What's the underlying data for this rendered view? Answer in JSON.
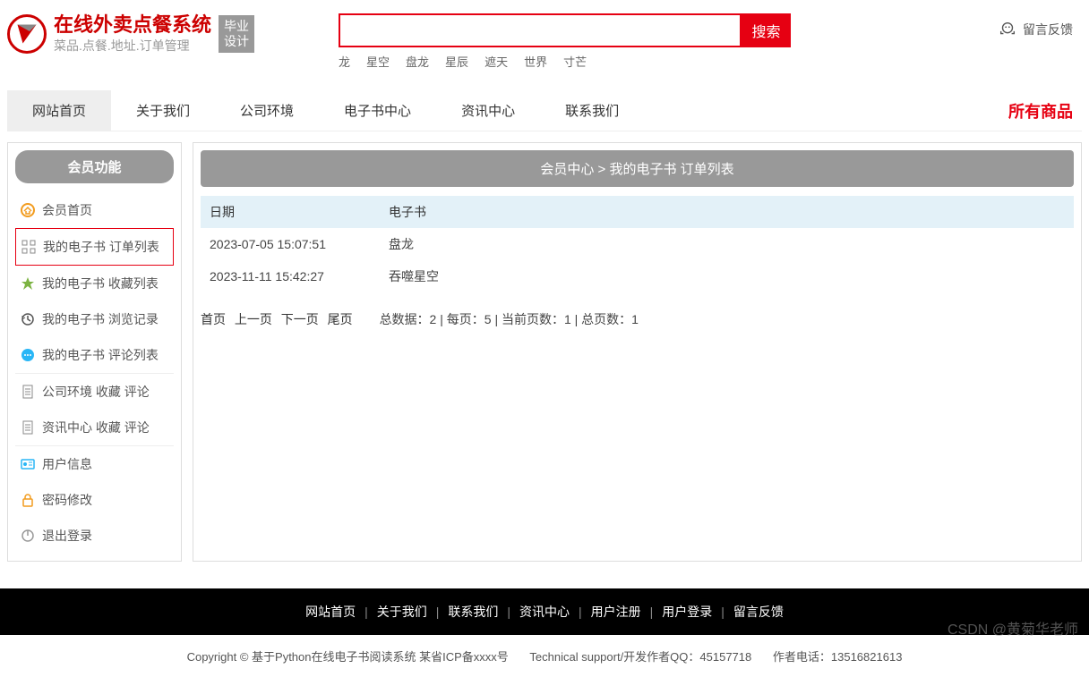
{
  "header": {
    "title": "在线外卖点餐系统",
    "subtitle": "菜品.点餐.地址.订单管理",
    "badge_line1": "毕业",
    "badge_line2": "设计",
    "search_button": "搜索",
    "search_placeholder": "",
    "hot_words": [
      "龙",
      "星空",
      "盘龙",
      "星辰",
      "遮天",
      "世界",
      "寸芒"
    ],
    "feedback": "留言反馈"
  },
  "nav": {
    "items": [
      "网站首页",
      "关于我们",
      "公司环境",
      "电子书中心",
      "资讯中心",
      "联系我们"
    ],
    "right": "所有商品"
  },
  "sidebar": {
    "header": "会员功能",
    "items": [
      {
        "label": "会员首页",
        "icon": "home",
        "color": "#F29C1F"
      },
      {
        "label": "我的电子书 订单列表",
        "icon": "grid",
        "color": "#888",
        "selected": true
      },
      {
        "label": "我的电子书 收藏列表",
        "icon": "star",
        "color": "#7CB342"
      },
      {
        "label": "我的电子书 浏览记录",
        "icon": "history",
        "color": "#555"
      },
      {
        "label": "我的电子书 评论列表",
        "icon": "comment",
        "color": "#29B6F6",
        "sep": true
      },
      {
        "label": "公司环境   收藏   评论",
        "icon": "doc",
        "color": "#888"
      },
      {
        "label": "资讯中心   收藏   评论",
        "icon": "doc",
        "color": "#888",
        "sep": true
      },
      {
        "label": "用户信息",
        "icon": "card",
        "color": "#29B6F6"
      },
      {
        "label": "密码修改",
        "icon": "lock",
        "color": "#F29C1F"
      },
      {
        "label": "退出登录",
        "icon": "power",
        "color": "#999"
      }
    ]
  },
  "main": {
    "breadcrumb": "会员中心 > 我的电子书 订单列表",
    "columns": [
      "日期",
      "电子书",
      ""
    ],
    "rows": [
      {
        "date": "2023-07-05 15:07:51",
        "book": "盘龙"
      },
      {
        "date": "2023-11-11 15:42:27",
        "book": "吞噬星空"
      }
    ],
    "pager": {
      "first": "首页",
      "prev": "上一页",
      "next": "下一页",
      "last": "尾页",
      "stats": "总数据：2 | 每页：5 | 当前页数：1 | 总页数：1"
    }
  },
  "footer": {
    "links": [
      "网站首页",
      "关于我们",
      "联系我们",
      "资讯中心",
      "用户注册",
      "用户登录",
      "留言反馈"
    ],
    "copyright": "Copyright © 基于Python在线电子书阅读系统 某省ICP备xxxx号",
    "support": "Technical support/开发作者QQ：45157718",
    "phone": "作者电话：13516821613"
  },
  "watermark": "CSDN @黄菊华老师"
}
